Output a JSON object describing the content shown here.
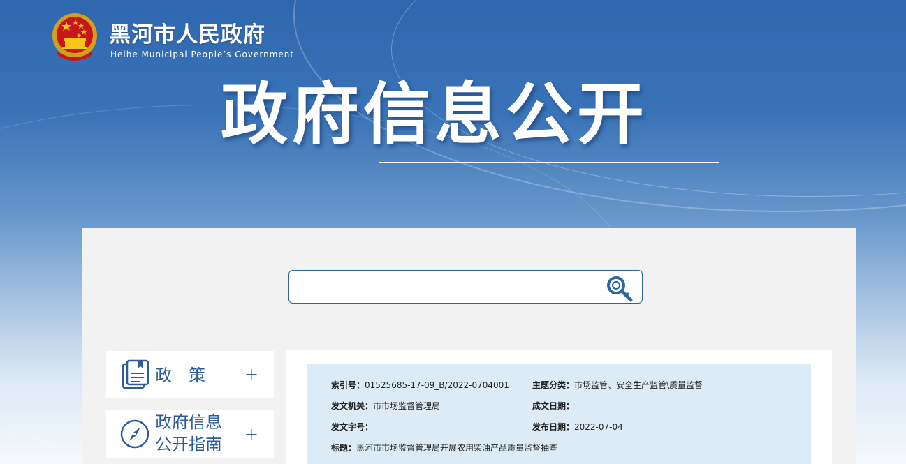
{
  "header": {
    "site_title": "黑河市人民政府",
    "site_subtitle": "Heihe Municipal People’s Government",
    "emblem_icon": "national-emblem-icon"
  },
  "banner": {
    "title": "政府信息公开"
  },
  "search": {
    "value": "",
    "icon": "search-key-icon"
  },
  "nav": {
    "items": [
      {
        "label": "政　策",
        "icon": "document-book-icon",
        "expand": "+"
      },
      {
        "label_line1": "政府信息",
        "label_line2": "公开指南",
        "icon": "compass-icon",
        "expand": "+"
      }
    ]
  },
  "document": {
    "index_label": "索引号：",
    "index_value": "01525685-17-09_B/2022-0704001",
    "topic_label": "主题分类：",
    "topic_value": "市场监管、安全生产监管\\质量监督",
    "issuer_label": "发文机关：",
    "issuer_value": "市市场监督管理局",
    "created_label": "成文日期：",
    "created_value": "",
    "docno_label": "发文字号：",
    "docno_value": "",
    "published_label": "发布日期：",
    "published_value": "2022-07-04",
    "title_label": "标题：",
    "title_value": "黑河市市场监督管理局开展农用柴油产品质量监督抽查"
  },
  "colors": {
    "accent": "#2c5d98",
    "meta_bg": "#dcebf6",
    "panel_bg": "#f2f2f2"
  }
}
